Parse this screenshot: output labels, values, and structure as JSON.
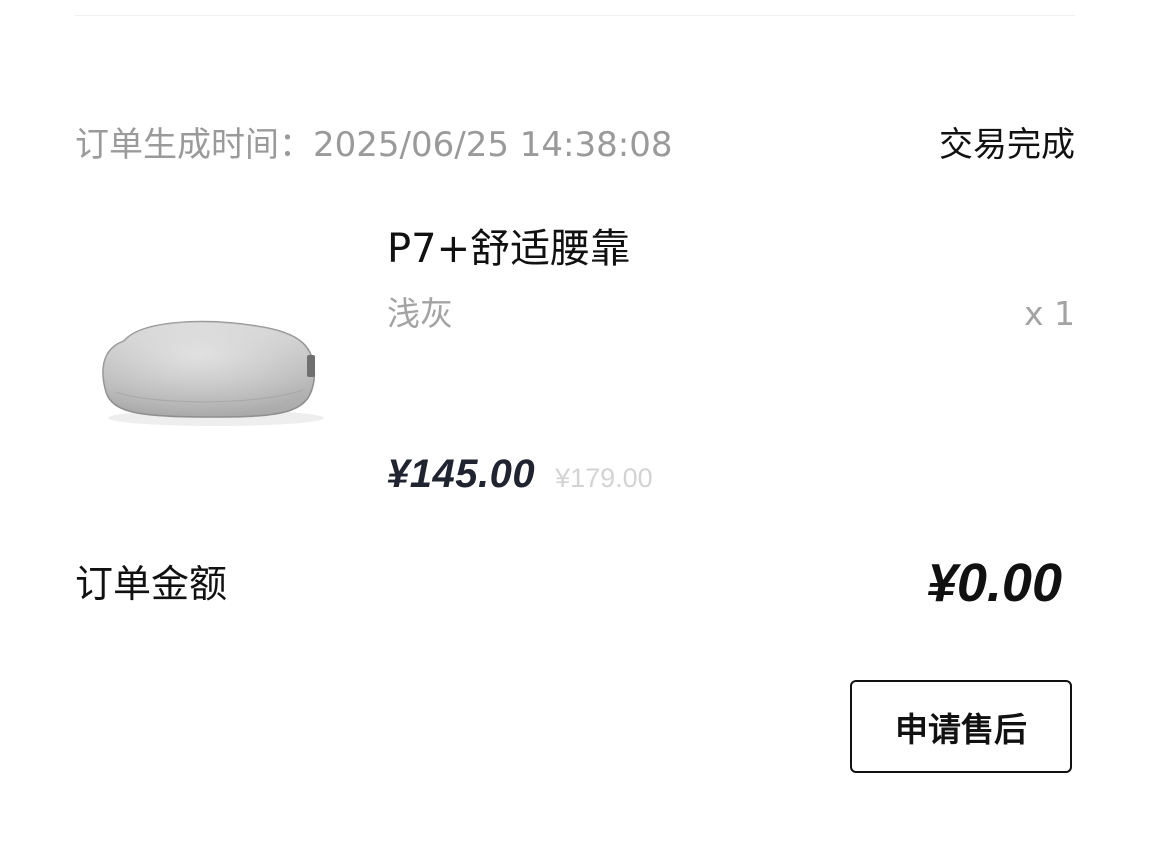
{
  "order": {
    "time_label": "订单生成时间：2025/06/25 14:38:08",
    "status": "交易完成"
  },
  "product": {
    "name": "P7+舒适腰靠",
    "variant": "浅灰",
    "quantity": "x 1",
    "sale_price": "¥145.00",
    "original_price": "¥179.00",
    "image_icon": "lumbar-pillow-image"
  },
  "summary": {
    "total_label": "订单金额",
    "total_value": "¥0.00"
  },
  "actions": {
    "after_sale_label": "申请售后"
  },
  "colors": {
    "primary_text": "#111111",
    "secondary_text": "#9a9a9a",
    "muted_price": "#d3d3d3",
    "price_text": "#1f2430",
    "button_border": "#111111"
  }
}
